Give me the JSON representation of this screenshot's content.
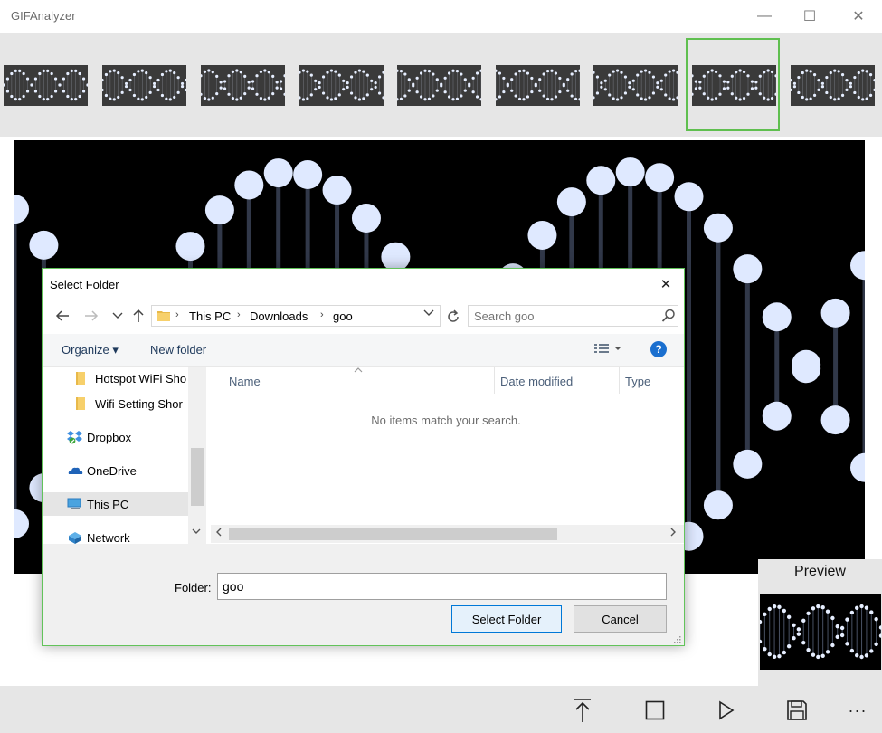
{
  "app": {
    "title": "GIFAnalyzer"
  },
  "window_controls": {
    "minimize": "—",
    "maximize": "☐",
    "close": "✕"
  },
  "thumbnails": {
    "count": 9,
    "selected_index": 7
  },
  "preview": {
    "title": "Preview"
  },
  "commands": {
    "upload_icon": "upload-icon",
    "stop_icon": "stop-icon",
    "play_icon": "play-icon",
    "save_icon": "save-icon",
    "more_label": "···"
  },
  "dialog": {
    "title": "Select Folder",
    "close_label": "✕",
    "breadcrumbs": [
      "This PC",
      "Downloads",
      "goo"
    ],
    "search": {
      "placeholder": "Search goo"
    },
    "toolbar": {
      "organize": "Organize ▾",
      "new_folder": "New folder",
      "help": "?"
    },
    "nav_items": [
      {
        "label": "Hotspot WiFi Sho",
        "icon": "folder-icon"
      },
      {
        "label": "Wifi Setting Shor",
        "icon": "folder-icon"
      },
      {
        "label": "Dropbox",
        "icon": "dropbox-icon"
      },
      {
        "label": "OneDrive",
        "icon": "onedrive-icon"
      },
      {
        "label": "This PC",
        "icon": "computer-icon"
      },
      {
        "label": "Network",
        "icon": "network-icon"
      }
    ],
    "nav_selected": "This PC",
    "columns": {
      "name": "Name",
      "date_modified": "Date modified",
      "type": "Type"
    },
    "empty_message": "No items match your search.",
    "folder_label": "Folder:",
    "folder_value": "goo",
    "buttons": {
      "select": "Select Folder",
      "cancel": "Cancel"
    }
  },
  "colors": {
    "accent_green": "#5fbf4f",
    "dialog_border": "#62c35a",
    "link_blue": "#1e395b",
    "help_blue": "#1a6fcf"
  }
}
